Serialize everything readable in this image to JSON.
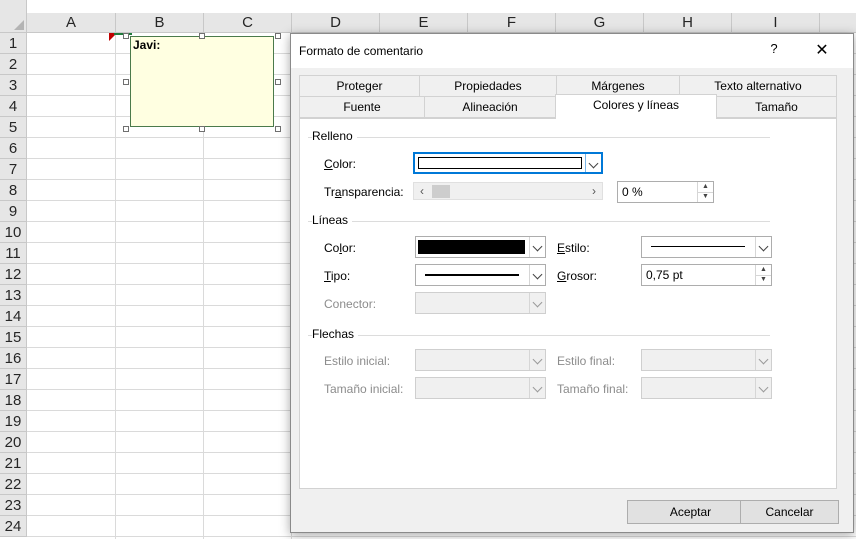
{
  "spreadsheet": {
    "columns": [
      "A",
      "B",
      "C",
      "D",
      "E",
      "F",
      "G",
      "H",
      "I"
    ],
    "rows": [
      "1",
      "2",
      "3",
      "4",
      "5",
      "6",
      "7",
      "8",
      "9",
      "10",
      "11",
      "12",
      "13",
      "14",
      "15",
      "16",
      "17",
      "18",
      "19",
      "20",
      "21",
      "22",
      "23",
      "24"
    ],
    "comment_author": "Javi:"
  },
  "dialog": {
    "title": "Formato de comentario",
    "help_label": "?",
    "close_label": "✕",
    "tabs_row1": [
      "Proteger",
      "Propiedades",
      "Márgenes",
      "Texto alternativo"
    ],
    "tabs_row2": [
      "Fuente",
      "Alineación",
      "Colores y líneas",
      "Tamaño"
    ],
    "active_tab": "Colores y líneas",
    "fill": {
      "section": "Relleno",
      "color_label_u": "C",
      "color_label_rest": "olor:",
      "transparency_label_a": "Tr",
      "transparency_label_u": "a",
      "transparency_label_b": "nsparencia:",
      "transparency_value": "0 %",
      "transparency_fraction": 0.0
    },
    "lines": {
      "section": "Líneas",
      "color_label_a": "Co",
      "color_label_u": "l",
      "color_label_b": "or:",
      "style_label_u": "E",
      "style_label_rest": "stilo:",
      "type_label_u": "T",
      "type_label_rest": "ipo:",
      "weight_label_u": "G",
      "weight_label_rest": "rosor:",
      "weight_value": "0,75 pt",
      "connector_label": "Conector:",
      "line_color": "#000000"
    },
    "arrows": {
      "section": "Flechas",
      "start_style": "Estilo inicial:",
      "end_style": "Estilo final:",
      "start_size": "Tamaño inicial:",
      "end_size": "Tamaño final:"
    },
    "ok_label": "Aceptar",
    "cancel_label": "Cancelar",
    "accent_color": "#0078d7"
  }
}
